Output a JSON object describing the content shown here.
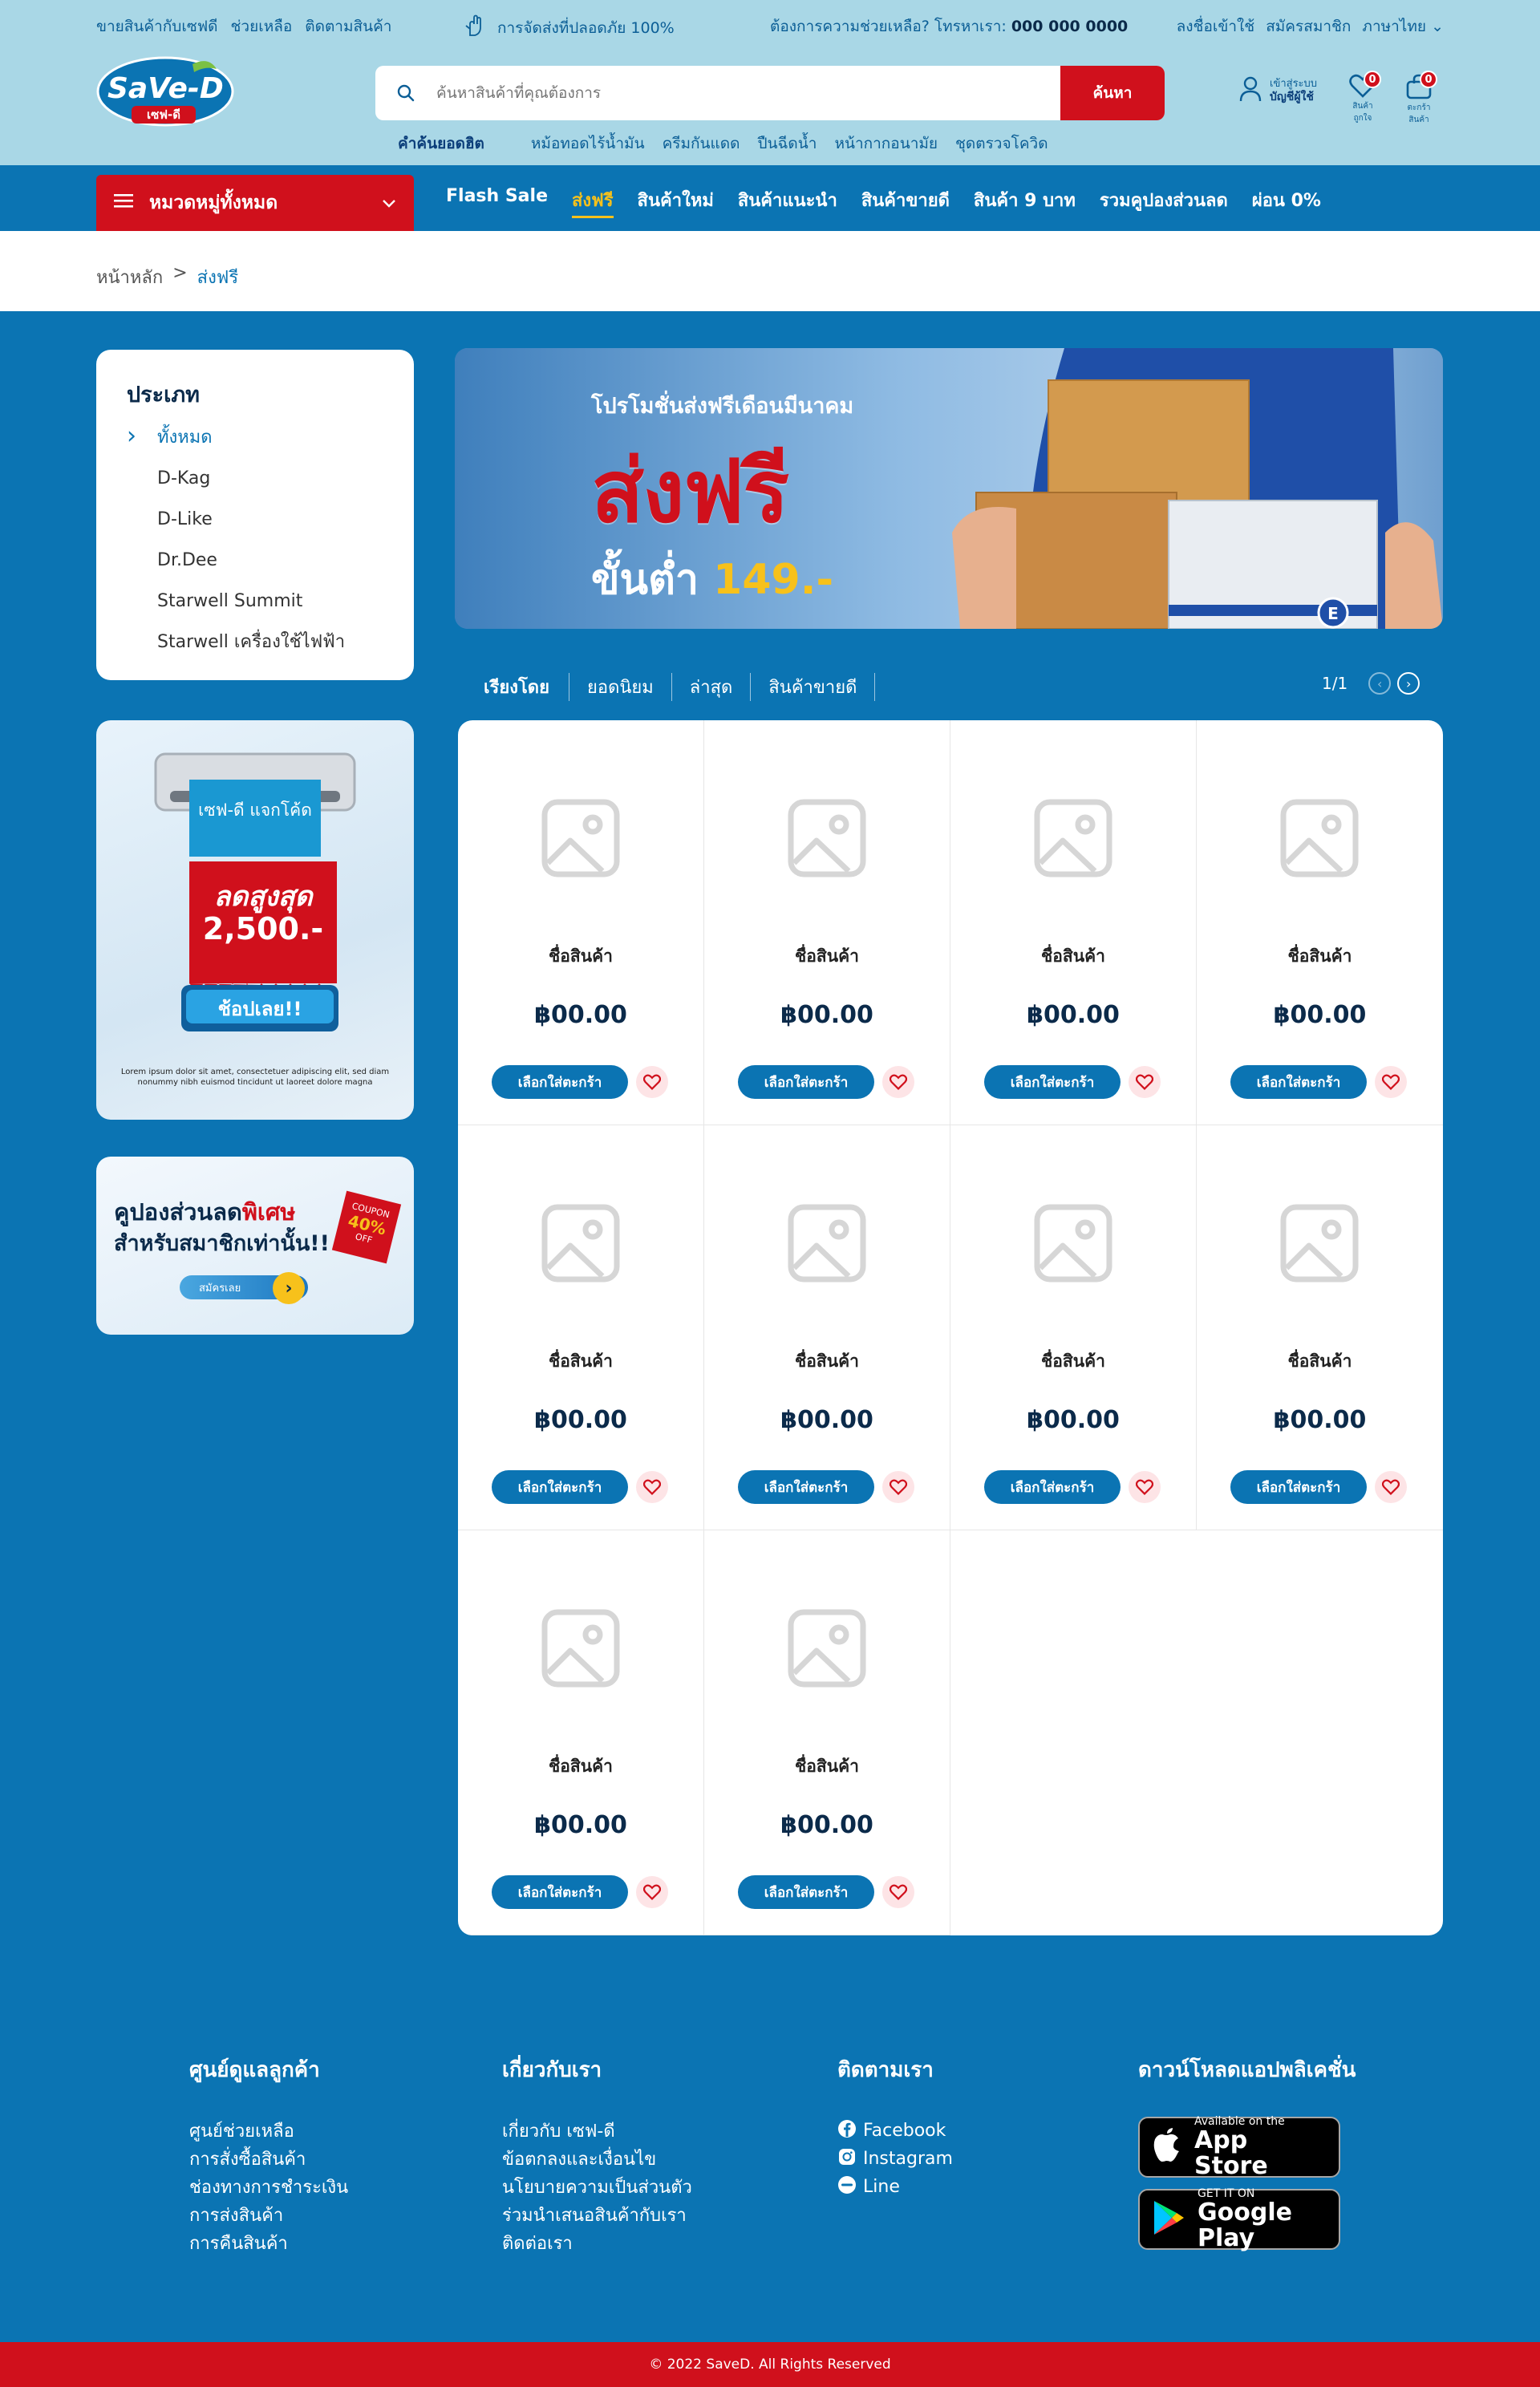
{
  "topbar": {
    "links": [
      "ขายสินค้ากับเซฟดี",
      "ช่วยเหลือ",
      "ติดตามสินค้า"
    ],
    "shipping_text": "การจัดส่งที่ปลอดภัย 100%",
    "help_text": "ต้องการความช่วยเหลือ? โทรหาเรา:",
    "phone": "000 000 0000",
    "auth_links": [
      "ลงชื่อเข้าใช้",
      "สมัครสมาชิก",
      "ภาษาไทย"
    ]
  },
  "logo": {
    "text": "SaVe-D",
    "sub": "เซฟ-ดี"
  },
  "search": {
    "placeholder": "ค้นหาสินค้าที่คุณต้องการ",
    "button": "ค้นหา"
  },
  "hotwords": {
    "label": "คำค้นยอดฮิต",
    "items": [
      "หม้อทอดไร้น้ำมัน",
      "ครีมกันแดด",
      "ปืนฉีดน้ำ",
      "หน้ากากอนามัย",
      "ชุดตรวจโควิด"
    ]
  },
  "account": {
    "line1": "เข้าสู่ระบบ",
    "line2": "บัญชีผู้ใช้"
  },
  "wishlist": {
    "label": "สินค้าถูกใจ",
    "count": "0"
  },
  "cart": {
    "label": "ตะกร้าสินค้า",
    "count": "0"
  },
  "nav": {
    "category_button": "หมวดหมู่ทั้งหมด",
    "links": [
      "Flash Sale",
      "ส่งฟรี",
      "สินค้าใหม่",
      "สินค้าแนะนำ",
      "สินค้าขายดี",
      "สินค้า 9 บาท",
      "รวมคูปองส่วนลด",
      "ผ่อน 0%"
    ],
    "active_index": 1
  },
  "breadcrumb": {
    "home": "หน้าหลัก",
    "sep": ">",
    "current": "ส่งฟรี"
  },
  "categories": {
    "title": "ประเภท",
    "items": [
      "ทั้งหมด",
      "D-Kag",
      "D-Like",
      "Dr.Dee",
      "Starwell Summit",
      "Starwell เครื่องใช้ไฟฟ้า"
    ]
  },
  "promo1": {
    "ribbon": "เซฟ-ดี แจกโค้ด",
    "discount_label": "ลดสูงสุด",
    "discount_value": "2,500.-",
    "button": "ช้อปเลย!!",
    "small_text": "Lorem ipsum dolor sit amet, consectetuer adipiscing elit, sed diam nonummy nibh euismod tincidunt ut laoreet dolore magna"
  },
  "promo2": {
    "line1a": "คูปองส่วนลด",
    "line1b": "พิเศษ",
    "line2": "สำหรับสมาชิกเท่านั้น!!",
    "coupon_label": "COUPON",
    "coupon_value": "40%",
    "coupon_off": "OFF",
    "button": "สมัครเลย"
  },
  "banner": {
    "sub": "โปรโมชั่นส่งฟรีเดือนมีนาคม",
    "big": "ส่งฟรี",
    "min_prefix": "ขั้นต่ำ",
    "min_value": "149.-"
  },
  "sort": {
    "label": "เรียงโดย",
    "options": [
      "ยอดนิยม",
      "ล่าสุด",
      "สินค้าขายดี"
    ],
    "page": "1/1"
  },
  "products": {
    "add_label": "เลือกใส่ตะกร้า",
    "items": [
      {
        "name": "ชื่อสินค้า",
        "price": "฿00.00"
      },
      {
        "name": "ชื่อสินค้า",
        "price": "฿00.00"
      },
      {
        "name": "ชื่อสินค้า",
        "price": "฿00.00"
      },
      {
        "name": "ชื่อสินค้า",
        "price": "฿00.00"
      },
      {
        "name": "ชื่อสินค้า",
        "price": "฿00.00"
      },
      {
        "name": "ชื่อสินค้า",
        "price": "฿00.00"
      },
      {
        "name": "ชื่อสินค้า",
        "price": "฿00.00"
      },
      {
        "name": "ชื่อสินค้า",
        "price": "฿00.00"
      },
      {
        "name": "ชื่อสินค้า",
        "price": "฿00.00"
      },
      {
        "name": "ชื่อสินค้า",
        "price": "฿00.00"
      }
    ]
  },
  "footer": {
    "support": {
      "title": "ศูนย์ดูแลลูกค้า",
      "links": [
        "ศูนย์ช่วยเหลือ",
        "การสั่งซื้อสินค้า",
        "ช่องทางการชำระเงิน",
        "การส่งสินค้า",
        "การคืนสินค้า"
      ]
    },
    "about": {
      "title": "เกี่ยวกับเรา",
      "links": [
        "เกี่ยวกับ เซฟ-ดี",
        "ข้อตกลงและเงื่อนไข",
        "นโยบายความเป็นส่วนตัว",
        "ร่วมนำเสนอสินค้ากับเรา",
        "ติดต่อเรา"
      ]
    },
    "follow": {
      "title": "ติดตามเรา",
      "links": [
        "Facebook",
        "Instagram",
        "Line"
      ]
    },
    "app": {
      "title": "ดาวน์โหลดแอปพลิเคชั่น",
      "appstore_small": "Available on the",
      "appstore_big": "App Store",
      "gplay_small": "GET IT ON",
      "gplay_big": "Google Play"
    },
    "copyright": "© 2022 SaveD. All Rights Reserved"
  }
}
